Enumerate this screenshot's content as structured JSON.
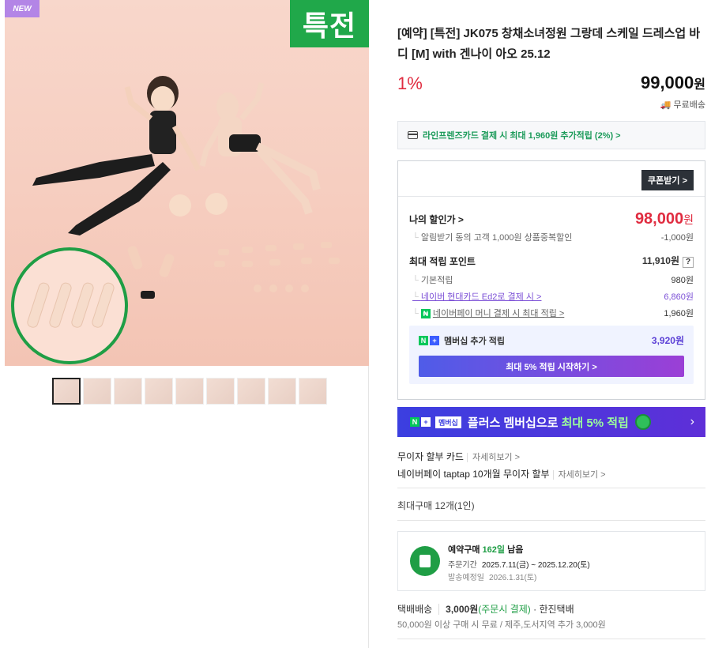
{
  "left": {
    "new_badge": "NEW",
    "special_badge": "특전",
    "thumbnails": [
      1,
      2,
      3,
      4,
      5,
      6,
      7,
      8,
      9
    ]
  },
  "product": {
    "title": "[예약] [특전] JK075 창채소녀정원 그랑데 스케일 드레스업 바디 [M] with 겐나이 아오 25.12",
    "discount_rate": "1%",
    "price": "99,000",
    "price_unit": "원",
    "shipping": "무료배송"
  },
  "card_benefit": "라인프렌즈카드 결제 시 최대 1,960원 추가적립 (2%) >",
  "coupon_button": "쿠폰받기 >",
  "my_price": {
    "label": "나의 할인가 >",
    "value": "98,000",
    "unit": "원",
    "sub_label": "알림받기 동의 고객 1,000원 상품중복할인",
    "sub_value": "-1,000원"
  },
  "points": {
    "label": "최대 적립 포인트",
    "value": "11,910원",
    "help": "?",
    "items": [
      {
        "label": "기본적립",
        "value": "980원"
      },
      {
        "label": "네이버 현대카드 Ed2로 결제 시 >",
        "value": "6,860원"
      },
      {
        "label": "네이버페이 머니 결제 시 최대 적립 >",
        "value": "1,960원"
      }
    ]
  },
  "membership": {
    "label": "멤버십 추가 적립",
    "amount": "3,920원",
    "button": "최대 5% 적립 시작하기 >"
  },
  "plus_banner": {
    "badge": "멤버십",
    "text1": "플러스 멤버십으로 ",
    "text2": "최대 5% 적립",
    "chevron": "›"
  },
  "installment": [
    {
      "label": "무이자 할부 카드",
      "more": "자세히보기 >"
    },
    {
      "label": "네이버페이 taptap 10개월 무이자 할부",
      "more": "자세히보기 >"
    }
  ],
  "max_purchase": "최대구매 12개(1인)",
  "preorder": {
    "title_prefix": "예약구매 ",
    "days": "162일",
    "title_suffix": " 남음",
    "period_label": "주문기간",
    "period_value": "2025.7.11(금) ~ 2025.12.20(토)",
    "ship_label": "발송예정일",
    "ship_value": "2026.1.31(토)"
  },
  "delivery": {
    "method": "택배배송",
    "fee": "3,000원",
    "fee_note": "(주문시 결제)",
    "carrier": "· 한진택배",
    "note": "50,000원 이상 구매 시 무료 / 제주,도서지역 추가 3,000원"
  },
  "colors": {
    "accent_red": "#e02c40",
    "green": "#1f9e45",
    "purple": "#5b3fd6"
  }
}
